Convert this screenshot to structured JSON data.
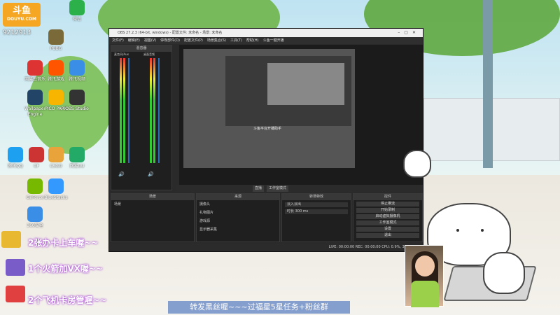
{
  "watermark": {
    "brand": "斗鱼",
    "site": "DOUYU.COM",
    "room": "9212913"
  },
  "desktop": {
    "icons": [
      {
        "label": "网易云音乐",
        "color": "#d33"
      },
      {
        "label": "腾讯游戏",
        "color": "#f50"
      },
      {
        "label": "腾讯视频",
        "color": "#3a8ee6"
      },
      {
        "label": "Wallpaper Engine",
        "color": "#246"
      },
      {
        "label": "PICO PARK",
        "color": "#f7b500"
      },
      {
        "label": "OBS Studio",
        "color": "#333"
      },
      {
        "label": "腾讯QQ",
        "color": "#1ea0f0"
      },
      {
        "label": "CF",
        "color": "#c33"
      },
      {
        "label": "CSGO",
        "color": "#e8a33a"
      },
      {
        "label": "网易UU",
        "color": "#2a6"
      },
      {
        "label": "GeForce",
        "color": "#76b900"
      },
      {
        "label": "BlueStacks",
        "color": "#39f"
      },
      {
        "label": "360安全",
        "color": "#3a8ee6"
      },
      {
        "label": "PUBG",
        "color": "#7a6a3a"
      },
      {
        "label": "微信",
        "color": "#2bb04a"
      }
    ]
  },
  "obs": {
    "title": "OBS 27.2.3 (64-bit, windows) - 配置文件: 未命名 - 场景: 未命名",
    "menu": [
      "文件(F)",
      "编辑(E)",
      "视图(V)",
      "停靠部件(D)",
      "配置文件(P)",
      "场景集合(S)",
      "工具(T)",
      "帮助(H)",
      "斗鱼一键开播"
    ],
    "mixer_title": "混音器",
    "mixer_channels": [
      "麦克风/Aux",
      "桌面音频"
    ],
    "studio_buttons": [
      "直播",
      "工作室模式"
    ],
    "docks": {
      "scenes": {
        "title": "场景",
        "items": [
          "场景"
        ]
      },
      "sources": {
        "title": "来源",
        "items": [
          "摄像头",
          "礼物图片",
          "游戏源",
          "显示器采集"
        ]
      },
      "transitions": {
        "title": "转场特效",
        "type": "淡入淡出",
        "duration_label": "时长",
        "duration": "300 ms"
      },
      "controls": {
        "title": "控件",
        "buttons": [
          "停止推流",
          "开始录制",
          "启动虚拟摄像机",
          "工作室模式",
          "设置",
          "退出"
        ]
      }
    },
    "status": "LIVE: 00:00:00   REC: 00:00:00   CPU: 0.9%, 30.00 fps",
    "preview_caption": "斗鱼平台开播助手"
  },
  "overlays": {
    "line1": "2张办卡上车喔~~",
    "line2": "1个火箭加VX喔~~",
    "line3": "2个飞机卡房管喔~~",
    "banner": "转发黑丝喔~~~过福星5星任务+粉丝群"
  }
}
